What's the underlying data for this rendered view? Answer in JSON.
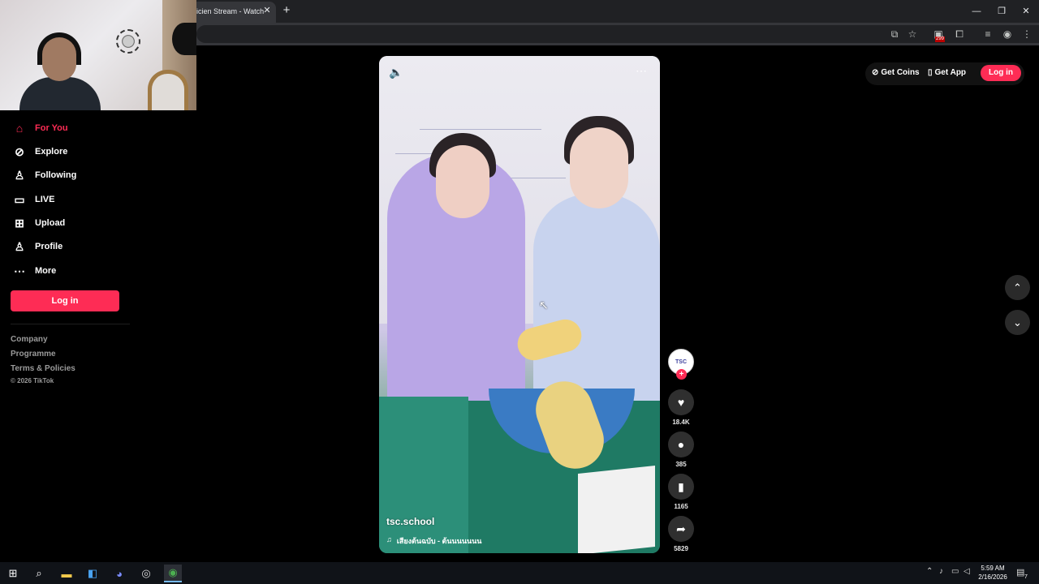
{
  "browser": {
    "tab_title": "icien Stream - Watch",
    "tab_close": "✕",
    "new_tab": "+",
    "window_controls": [
      "—",
      "❐",
      "✕"
    ],
    "extension_badge": "299"
  },
  "sidebar": {
    "items": [
      {
        "label": "For You",
        "icon": "home-icon",
        "active": true
      },
      {
        "label": "Explore",
        "icon": "compass-icon",
        "active": false
      },
      {
        "label": "Following",
        "icon": "following-icon",
        "active": false
      },
      {
        "label": "LIVE",
        "icon": "live-icon",
        "active": false
      },
      {
        "label": "Upload",
        "icon": "upload-icon",
        "active": false
      },
      {
        "label": "Profile",
        "icon": "profile-icon",
        "active": false
      },
      {
        "label": "More",
        "icon": "more-icon",
        "active": false
      }
    ],
    "login_label": "Log in",
    "footer_links": [
      "Company",
      "Programme",
      "Terms & Policies"
    ],
    "copyright": "© 2026 TikTok"
  },
  "video": {
    "author": "tsc.school",
    "music": "เสียงต้นฉบับ - ต้นนนนนนน",
    "music_icon": "♫"
  },
  "actions": {
    "avatar_text": "TSC",
    "likes": "18.4K",
    "comments": "385",
    "saves": "1165",
    "shares": "5829"
  },
  "header": {
    "get_coins": "Get Coins",
    "get_app": "Get App",
    "login": "Log in"
  },
  "taskbar": {
    "time": "5:59 AM",
    "date": "2/16/2026",
    "notification_count": "7"
  },
  "colors": {
    "accent": "#fe2c55",
    "background": "#000000"
  }
}
